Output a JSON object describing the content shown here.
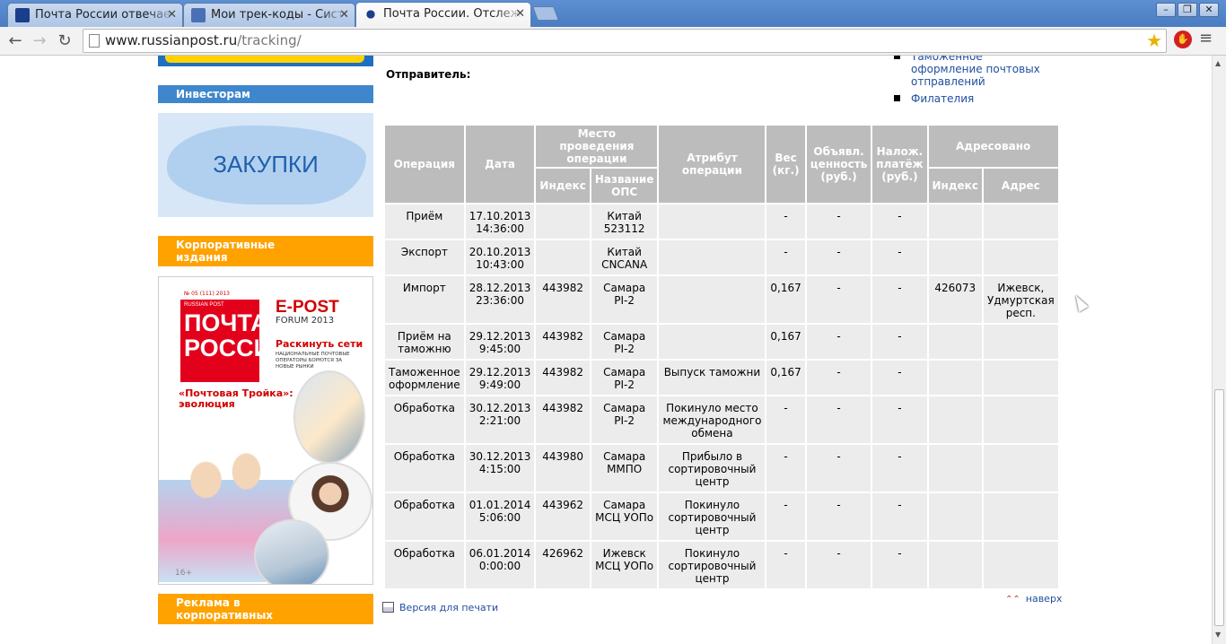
{
  "browser": {
    "tabs": [
      {
        "title": "Почта России отвечае",
        "active": false
      },
      {
        "title": "Мои трек-коды - Систе",
        "active": false
      },
      {
        "title": "Почта России. Отслеж",
        "active": true
      }
    ],
    "url_host": "www.russianpost.ru",
    "url_path": "/tracking/"
  },
  "sidebar": {
    "investors": "Инвесторам",
    "zakupki": "ЗАКУПКИ",
    "corporate": "Корпоративные издания",
    "ads": "Реклама в корпоративных изданиях",
    "magazine": {
      "issue": "№ 05 (111) 2013",
      "publisher": "RUSSIAN POST",
      "logo": "ПОЧТА РОССИИ",
      "epost": "E-POST",
      "forum": "FORUM 2013",
      "headline": "Раскинуть сети",
      "headline_sub": "НАЦИОНАЛЬНЫЕ ПОЧТОВЫЕ ОПЕРАТОРЫ БОРЮТСЯ ЗА НОВЫЕ РЫНКИ",
      "troika": "«Почтовая Тройка»: эволюция",
      "age": "16+"
    }
  },
  "right_links": [
    "Таможенное оформление почтовых отправлений",
    "Филателия"
  ],
  "sender_label": "Отправитель:",
  "table": {
    "headers": {
      "operation": "Операция",
      "date": "Дата",
      "place": "Место проведения операции",
      "place_index": "Индекс",
      "place_name": "Название ОПС",
      "attribute": "Атрибут операции",
      "weight": "Вес (кг.)",
      "declared": "Объявл. ценность (руб.)",
      "cod": "Налож. платёж (руб.)",
      "addressed": "Адресовано",
      "addr_index": "Индекс",
      "addr_address": "Адрес"
    },
    "rows": [
      {
        "op": "Приём",
        "date": "17.10.2013 14:36:00",
        "index": "",
        "name": "Китай 523112",
        "attr": "",
        "weight": "-",
        "declared": "-",
        "cod": "-",
        "aindex": "",
        "address": ""
      },
      {
        "op": "Экспорт",
        "date": "20.10.2013 10:43:00",
        "index": "",
        "name": "Китай CNCANA",
        "attr": "",
        "weight": "-",
        "declared": "-",
        "cod": "-",
        "aindex": "",
        "address": ""
      },
      {
        "op": "Импорт",
        "date": "28.12.2013 23:36:00",
        "index": "443982",
        "name": "Самара PI-2",
        "attr": "",
        "weight": "0,167",
        "declared": "-",
        "cod": "-",
        "aindex": "426073",
        "address": "Ижевск, Удмуртская респ."
      },
      {
        "op": "Приём на таможню",
        "date": "29.12.2013 9:45:00",
        "index": "443982",
        "name": "Самара PI-2",
        "attr": "",
        "weight": "0,167",
        "declared": "-",
        "cod": "-",
        "aindex": "",
        "address": ""
      },
      {
        "op": "Таможенное оформление",
        "date": "29.12.2013 9:49:00",
        "index": "443982",
        "name": "Самара PI-2",
        "attr": "Выпуск таможни",
        "weight": "0,167",
        "declared": "-",
        "cod": "-",
        "aindex": "",
        "address": ""
      },
      {
        "op": "Обработка",
        "date": "30.12.2013 2:21:00",
        "index": "443982",
        "name": "Самара PI-2",
        "attr": "Покинуло место международного обмена",
        "weight": "-",
        "declared": "-",
        "cod": "-",
        "aindex": "",
        "address": ""
      },
      {
        "op": "Обработка",
        "date": "30.12.2013 4:15:00",
        "index": "443980",
        "name": "Самара ММПО",
        "attr": "Прибыло в сортировочный центр",
        "weight": "-",
        "declared": "-",
        "cod": "-",
        "aindex": "",
        "address": ""
      },
      {
        "op": "Обработка",
        "date": "01.01.2014 5:06:00",
        "index": "443962",
        "name": "Самара МСЦ УОПо",
        "attr": "Покинуло сортировочный центр",
        "weight": "-",
        "declared": "-",
        "cod": "-",
        "aindex": "",
        "address": ""
      },
      {
        "op": "Обработка",
        "date": "06.01.2014 0:00:00",
        "index": "426962",
        "name": "Ижевск МСЦ УОПо",
        "attr": "Покинуло сортировочный центр",
        "weight": "-",
        "declared": "-",
        "cod": "-",
        "aindex": "",
        "address": ""
      }
    ]
  },
  "print_label": "Версия для печати",
  "top_label": "наверх",
  "colors": {
    "accent_blue": "#3f87cc",
    "accent_orange": "#ffa200",
    "link": "#1f4fa0",
    "header_gray": "#bcbcbc"
  }
}
